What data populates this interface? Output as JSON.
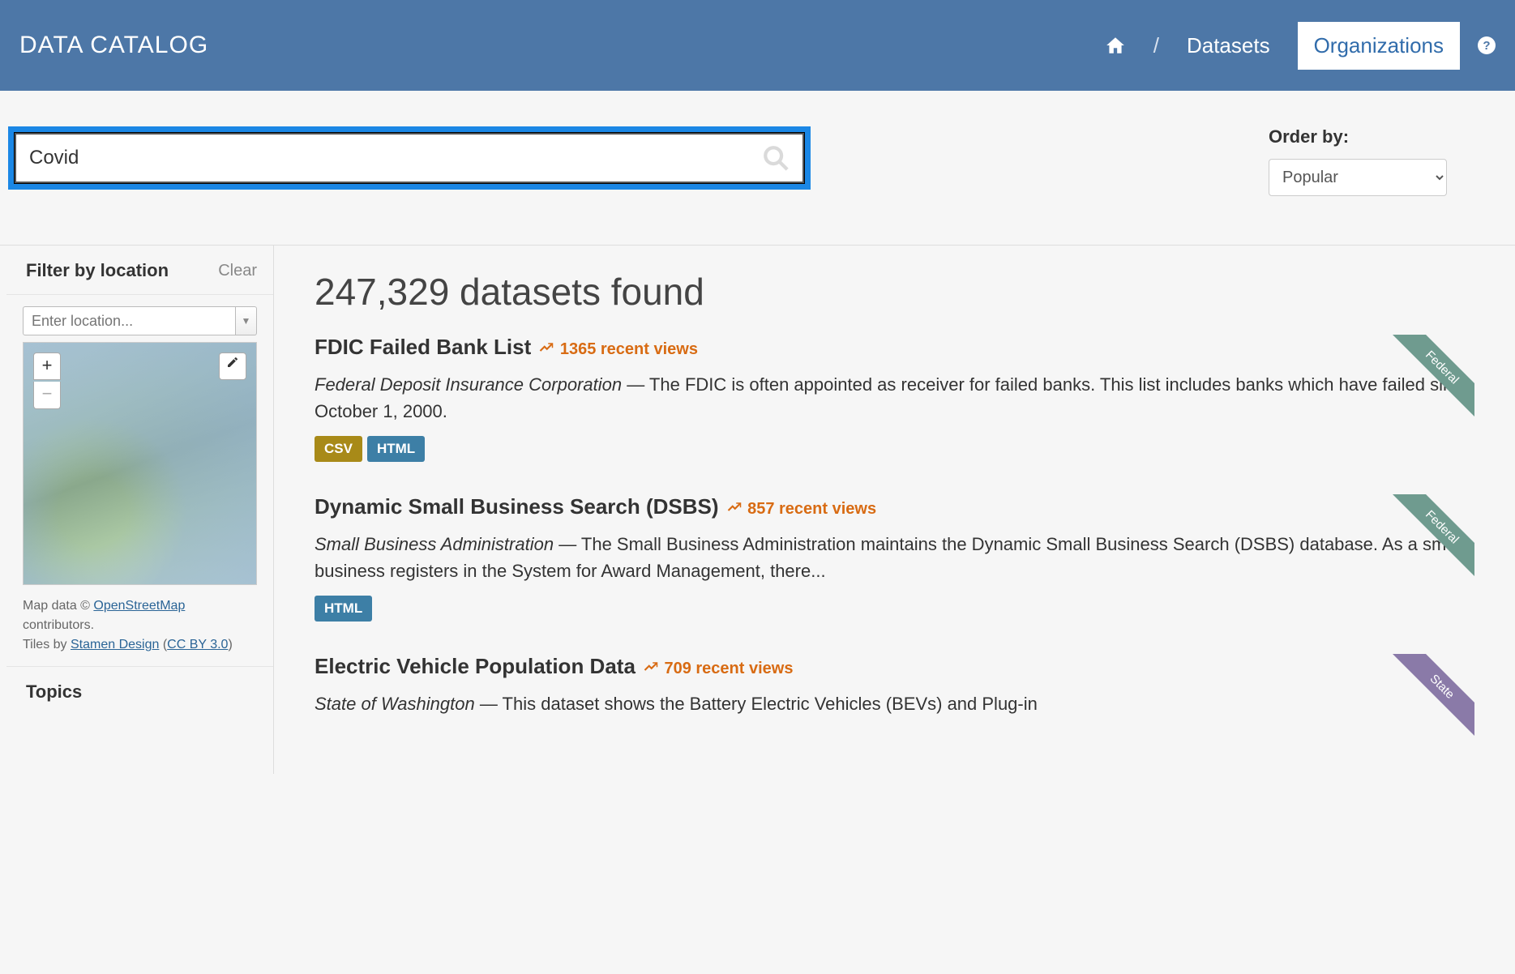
{
  "header": {
    "site_title": "DATA CATALOG",
    "breadcrumb_sep": "/",
    "datasets_label": "Datasets",
    "organizations_label": "Organizations"
  },
  "search": {
    "value": "Covid",
    "placeholder": ""
  },
  "order": {
    "label": "Order by:",
    "selected": "Popular"
  },
  "sidebar": {
    "location_title": "Filter by location",
    "clear_label": "Clear",
    "location_placeholder": "Enter location...",
    "zoom_in": "+",
    "zoom_out": "−",
    "attrib_prefix": "Map data © ",
    "osm_link": "OpenStreetMap",
    "attrib_contrib": " contributors.",
    "tiles_prefix": "Tiles by ",
    "stamen_link": "Stamen Design",
    "license_open": " (",
    "cc_link": "CC BY 3.0",
    "license_close": ")",
    "topics_title": "Topics"
  },
  "results": {
    "count_text": "247,329 datasets found",
    "items": [
      {
        "title": "FDIC Failed Bank List",
        "views": "1365 recent views",
        "org": "Federal Deposit Insurance Corporation",
        "sep": " — ",
        "desc": "The FDIC is often appointed as receiver for failed banks. This list includes banks which have failed since October 1, 2000.",
        "formats": [
          "CSV",
          "HTML"
        ],
        "ribbon": "Federal",
        "ribbon_class": "federal"
      },
      {
        "title": "Dynamic Small Business Search (DSBS)",
        "views": "857 recent views",
        "org": "Small Business Administration",
        "sep": " — ",
        "desc": "The Small Business Administration maintains the Dynamic Small Business Search (DSBS) database. As a small business registers in the System for Award Management, there...",
        "formats": [
          "HTML"
        ],
        "ribbon": "Federal",
        "ribbon_class": "federal"
      },
      {
        "title": "Electric Vehicle Population Data",
        "views": "709 recent views",
        "org": "State of Washington",
        "sep": " — ",
        "desc": "This dataset shows the Battery Electric Vehicles (BEVs) and Plug-in",
        "formats": [],
        "ribbon": "State",
        "ribbon_class": "state"
      }
    ]
  }
}
